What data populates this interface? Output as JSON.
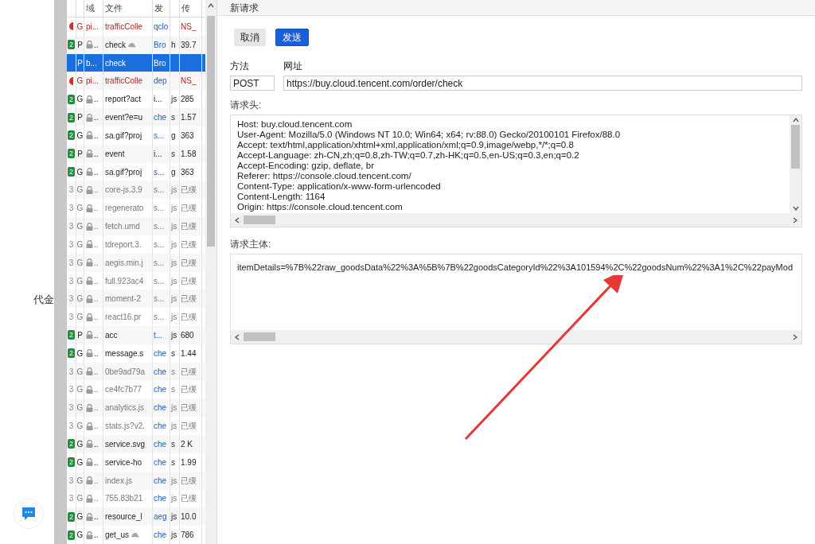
{
  "page_behind": {
    "label": "代金"
  },
  "network_table": {
    "columns": [
      {
        "kind": "status"
      },
      {
        "kind": "method"
      },
      {
        "kind": "domain",
        "label": "域"
      },
      {
        "kind": "file",
        "label": "文件"
      },
      {
        "kind": "initiator",
        "label": "发"
      },
      {
        "kind": "type"
      },
      {
        "kind": "transferred",
        "label": "传"
      }
    ],
    "rows": [
      {
        "kind": "error",
        "method": "G",
        "domain": "pi...",
        "secure": false,
        "file": "trafficColle",
        "slow": false,
        "initiator": "qclo",
        "initiator_link": true,
        "transferred": "NS_",
        "selected": false
      },
      {
        "kind": "ok",
        "code": "2",
        "method": "P",
        "domain": "..",
        "secure": true,
        "file": "check",
        "slow": true,
        "initiator": "Bro",
        "initiator_link": true,
        "type": "h",
        "transferred": "39.7",
        "selected": false
      },
      {
        "kind": "pending",
        "method": "P",
        "domain": "b...",
        "secure": false,
        "file": "check",
        "slow": false,
        "initiator": "Bro",
        "selected": true
      },
      {
        "kind": "error",
        "method": "G",
        "domain": "pi...",
        "secure": false,
        "file": "trafficColle",
        "slow": false,
        "initiator": "dep",
        "initiator_link": true,
        "transferred": "NS_",
        "selected": false
      },
      {
        "kind": "ok",
        "code": "2",
        "method": "G",
        "domain": "..",
        "secure": true,
        "file": "report?act",
        "slow": false,
        "initiator": "i...",
        "initiator_link": false,
        "type": "js",
        "transferred": "285",
        "selected": false
      },
      {
        "kind": "ok",
        "code": "2",
        "method": "P",
        "domain": "..",
        "secure": true,
        "file": "event?e=u",
        "slow": false,
        "initiator": "che",
        "initiator_link": true,
        "type": "s",
        "transferred": "1.57",
        "selected": false
      },
      {
        "kind": "ok",
        "code": "2",
        "method": "G",
        "domain": "..",
        "secure": true,
        "file": "sa.gif?proj",
        "slow": false,
        "initiator": "s...",
        "initiator_link": true,
        "type": "g",
        "transferred": "363",
        "selected": false
      },
      {
        "kind": "ok",
        "code": "2",
        "method": "P",
        "domain": "..",
        "secure": true,
        "file": "event",
        "slow": false,
        "initiator": "i...",
        "initiator_link": false,
        "type": "s",
        "transferred": "1.58",
        "selected": false
      },
      {
        "kind": "ok",
        "code": "2",
        "method": "G",
        "domain": "..",
        "secure": true,
        "file": "sa.gif?proj",
        "slow": false,
        "initiator": "s...",
        "initiator_link": true,
        "type": "g",
        "transferred": "363",
        "selected": false
      },
      {
        "kind": "cached",
        "code": "3",
        "method": "G",
        "domain": "..",
        "secure": true,
        "file": "core-js.3.9",
        "slow": false,
        "initiator": "s...",
        "initiator_link": false,
        "type": "js",
        "transferred": "已缓",
        "selected": false
      },
      {
        "kind": "cached",
        "code": "3",
        "method": "G",
        "domain": "..",
        "secure": true,
        "file": "regenerato",
        "slow": false,
        "initiator": "s...",
        "initiator_link": false,
        "type": "js",
        "transferred": "已缓",
        "selected": false
      },
      {
        "kind": "cached",
        "code": "3",
        "method": "G",
        "domain": "..",
        "secure": true,
        "file": "fetch.umd",
        "slow": false,
        "initiator": "s...",
        "initiator_link": false,
        "type": "js",
        "transferred": "已缓",
        "selected": false
      },
      {
        "kind": "cached",
        "code": "3",
        "method": "G",
        "domain": "..",
        "secure": true,
        "file": "tdreport.3.",
        "slow": false,
        "initiator": "s...",
        "initiator_link": false,
        "type": "js",
        "transferred": "已缓",
        "selected": false
      },
      {
        "kind": "cached",
        "code": "3",
        "method": "G",
        "domain": "..",
        "secure": true,
        "file": "aegis.min.j",
        "slow": false,
        "initiator": "s...",
        "initiator_link": false,
        "type": "js",
        "transferred": "已缓",
        "selected": false
      },
      {
        "kind": "cached",
        "code": "3",
        "method": "G",
        "domain": "..",
        "secure": true,
        "file": "full.923ac4",
        "slow": false,
        "initiator": "s...",
        "initiator_link": false,
        "type": "js",
        "transferred": "已缓",
        "selected": false
      },
      {
        "kind": "cached",
        "code": "3",
        "method": "G",
        "domain": "..",
        "secure": true,
        "file": "moment-2",
        "slow": false,
        "initiator": "s...",
        "initiator_link": false,
        "type": "js",
        "transferred": "已缓",
        "selected": false
      },
      {
        "kind": "cached",
        "code": "3",
        "method": "G",
        "domain": "..",
        "secure": true,
        "file": "react16.pr",
        "slow": false,
        "initiator": "s...",
        "initiator_link": false,
        "type": "js",
        "transferred": "已缓",
        "selected": false
      },
      {
        "kind": "ok",
        "code": "2",
        "method": "P",
        "domain": "..",
        "secure": true,
        "file": "acc",
        "slow": false,
        "initiator": "t...",
        "initiator_link": true,
        "type": "js",
        "transferred": "680",
        "selected": false
      },
      {
        "kind": "ok",
        "code": "2",
        "method": "G",
        "domain": "..",
        "secure": true,
        "file": "message.s",
        "slow": false,
        "initiator": "che",
        "initiator_link": true,
        "type": "s",
        "transferred": "1.44",
        "selected": false
      },
      {
        "kind": "cached",
        "code": "3",
        "method": "G",
        "domain": "..",
        "secure": true,
        "file": "0be9ad79a",
        "slow": false,
        "initiator": "che",
        "initiator_link": true,
        "type": "s",
        "transferred": "已缓",
        "selected": false
      },
      {
        "kind": "cached",
        "code": "3",
        "method": "G",
        "domain": "..",
        "secure": true,
        "file": "ce4fc7b77",
        "slow": false,
        "initiator": "che",
        "initiator_link": true,
        "type": "s",
        "transferred": "已缓",
        "selected": false
      },
      {
        "kind": "cached",
        "code": "3",
        "method": "G",
        "domain": "..",
        "secure": true,
        "file": "analytics.js",
        "slow": false,
        "initiator": "che",
        "initiator_link": true,
        "type": "js",
        "transferred": "已缓",
        "selected": false
      },
      {
        "kind": "cached",
        "code": "3",
        "method": "G",
        "domain": "..",
        "secure": true,
        "file": "stats.js?v2.",
        "slow": false,
        "initiator": "che",
        "initiator_link": true,
        "type": "js",
        "transferred": "已缓",
        "selected": false
      },
      {
        "kind": "ok",
        "code": "2",
        "method": "G",
        "domain": "..",
        "secure": true,
        "file": "service.svg",
        "slow": false,
        "initiator": "che",
        "initiator_link": true,
        "type": "s",
        "transferred": "2 K",
        "selected": false
      },
      {
        "kind": "ok",
        "code": "2",
        "method": "G",
        "domain": "..",
        "secure": true,
        "file": "service-ho",
        "slow": false,
        "initiator": "che",
        "initiator_link": true,
        "type": "s",
        "transferred": "1.99",
        "selected": false
      },
      {
        "kind": "cached",
        "code": "3",
        "method": "G",
        "domain": "..",
        "secure": true,
        "file": "index.js",
        "slow": false,
        "initiator": "che",
        "initiator_link": true,
        "type": "js",
        "transferred": "已缓",
        "selected": false
      },
      {
        "kind": "cached",
        "code": "3",
        "method": "G",
        "domain": "..",
        "secure": true,
        "file": "755.83b21",
        "slow": false,
        "initiator": "che",
        "initiator_link": true,
        "type": "js",
        "transferred": "已缓",
        "selected": false
      },
      {
        "kind": "ok",
        "code": "2",
        "method": "G",
        "domain": "..",
        "secure": true,
        "file": "resource_l",
        "slow": false,
        "initiator": "aeg",
        "initiator_link": true,
        "type": "js",
        "transferred": "10.0",
        "selected": false
      },
      {
        "kind": "ok",
        "code": "2",
        "method": "G",
        "domain": "..",
        "secure": true,
        "file": "get_us",
        "slow": true,
        "initiator": "che",
        "initiator_link": true,
        "type": "js",
        "transferred": "786",
        "selected": false
      }
    ]
  },
  "request_editor": {
    "title": "新请求",
    "buttons": [
      {
        "label": "取消",
        "kind": "secondary"
      },
      {
        "label": "发送",
        "kind": "primary"
      }
    ],
    "method": {
      "label": "方法",
      "value": "POST"
    },
    "url": {
      "label": "网址",
      "value": "https://buy.cloud.tencent.com/order/check"
    },
    "headers": {
      "label": "请求头:",
      "lines": [
        "Host: buy.cloud.tencent.com",
        "User-Agent: Mozilla/5.0 (Windows NT 10.0; Win64; x64; rv:88.0) Gecko/20100101 Firefox/88.0",
        "Accept: text/html,application/xhtml+xml,application/xml;q=0.9,image/webp,*/*;q=0.8",
        "Accept-Language: zh-CN,zh;q=0.8,zh-TW;q=0.7,zh-HK;q=0.5,en-US;q=0.3,en;q=0.2",
        "Accept-Encoding: gzip, deflate, br",
        "Referer: https://console.cloud.tencent.com/",
        "Content-Type: application/x-www-form-urlencoded",
        "Content-Length: 1164",
        "Origin: https://console.cloud.tencent.com"
      ]
    },
    "body": {
      "label": "请求主体:",
      "value": "itemDetails=%7B%22raw_goodsData%22%3A%5B%7B%22goodsCategoryId%22%3A101594%2C%22goodsNum%22%3A1%2C%22payMod"
    }
  }
}
